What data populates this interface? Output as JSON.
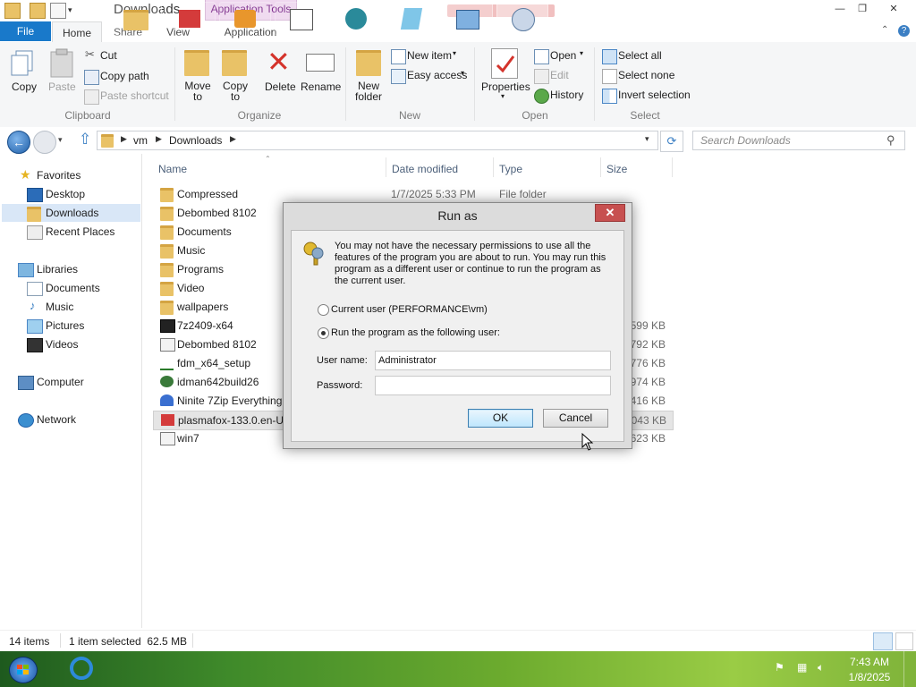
{
  "window": {
    "title": "Downloads",
    "contextual_tab": "Application Tools",
    "controls": {
      "minimize": "—",
      "maximize": "❐",
      "close": "✕"
    }
  },
  "tabs": {
    "file": "File",
    "home": "Home",
    "share": "Share",
    "view": "View",
    "application": "Application"
  },
  "ribbon": {
    "clipboard": {
      "copy": "Copy",
      "paste": "Paste",
      "cut": "Cut",
      "copy_path": "Copy path",
      "paste_shortcut": "Paste shortcut",
      "group": "Clipboard"
    },
    "organize": {
      "move_to": "Move to",
      "copy_to": "Copy to",
      "delete": "Delete",
      "rename": "Rename",
      "group": "Organize"
    },
    "new": {
      "new_folder": "New folder",
      "new_item": "New item",
      "easy_access": "Easy access",
      "group": "New"
    },
    "open": {
      "properties": "Properties",
      "open": "Open",
      "edit": "Edit",
      "history": "History",
      "group": "Open"
    },
    "select": {
      "select_all": "Select all",
      "select_none": "Select none",
      "invert_selection": "Invert selection",
      "group": "Select"
    }
  },
  "address": {
    "crumbs": [
      "vm",
      "Downloads"
    ],
    "search_placeholder": "Search Downloads"
  },
  "nav": {
    "favorites": "Favorites",
    "desktop": "Desktop",
    "downloads": "Downloads",
    "recent": "Recent Places",
    "libraries": "Libraries",
    "documents": "Documents",
    "music": "Music",
    "pictures": "Pictures",
    "videos": "Videos",
    "computer": "Computer",
    "network": "Network"
  },
  "columns": {
    "name": "Name",
    "date": "Date modified",
    "type": "Type",
    "size": "Size"
  },
  "files": [
    {
      "name": "Compressed",
      "date": "1/7/2025 5:33 PM",
      "type": "File folder",
      "size": ""
    },
    {
      "name": "Debombed 8102",
      "date": "",
      "type": "",
      "size": ""
    },
    {
      "name": "Documents",
      "date": "",
      "type": "",
      "size": ""
    },
    {
      "name": "Music",
      "date": "",
      "type": "",
      "size": ""
    },
    {
      "name": "Programs",
      "date": "",
      "type": "",
      "size": ""
    },
    {
      "name": "Video",
      "date": "",
      "type": "",
      "size": ""
    },
    {
      "name": "wallpapers",
      "date": "",
      "type": "",
      "size": ""
    },
    {
      "name": "7z2409-x64",
      "date": "",
      "type": "",
      "size": "1,599 KB"
    },
    {
      "name": "Debombed 8102",
      "date": "",
      "type": "",
      "size": "792 KB"
    },
    {
      "name": "fdm_x64_setup",
      "date": "",
      "type": "",
      "size": "1,776 KB"
    },
    {
      "name": "idman642build26",
      "date": "",
      "type": "",
      "size": "1,974 KB"
    },
    {
      "name": "Ninite 7Zip Everything",
      "date": "",
      "type": "",
      "size": "416 KB"
    },
    {
      "name": "plasmafox-133.0.en-US",
      "date": "",
      "type": "",
      "size": "1,043 KB"
    },
    {
      "name": "win7",
      "date": "",
      "type": "",
      "size": "1,623 KB"
    }
  ],
  "status": {
    "count": "14 items",
    "selected": "1 item selected  62.5 MB"
  },
  "dialog": {
    "title": "Run as",
    "close": "✕",
    "message": "You may not have the necessary permissions to use all the features of the program you are about to run. You may run this program as a different user or continue to run the program as the current user.",
    "current_user": "Current user (PERFORMANCE\\vm)",
    "run_as_other": "Run the program as the following user:",
    "username_label": "User name:",
    "username_value": "Administrator",
    "password_label": "Password:",
    "ok": "OK",
    "cancel": "Cancel"
  },
  "taskbar": {
    "time": "7:43 AM",
    "date": "1/8/2025"
  }
}
